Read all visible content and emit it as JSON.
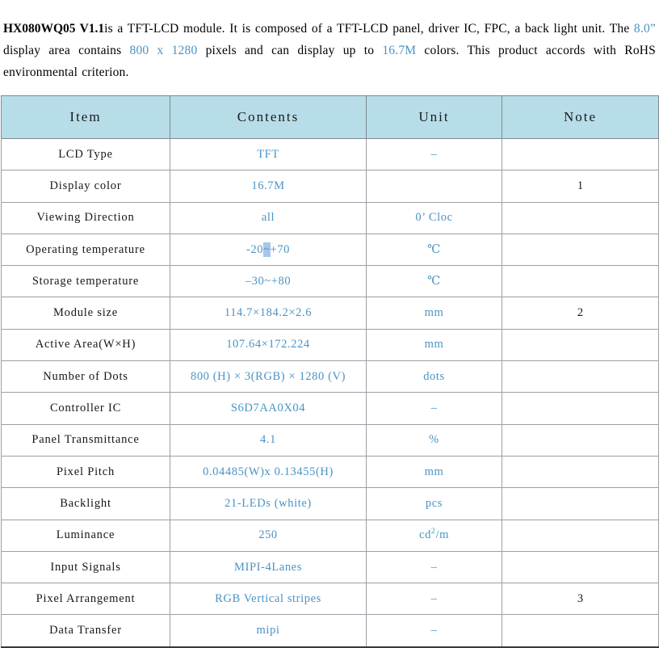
{
  "intro": {
    "model": "HX080WQ05 V1.1",
    "segment_1": "is a TFT-LCD module. It is composed of a TFT-LCD panel, driver IC, FPC, a back light unit. The ",
    "size_value": "8.0”",
    "segment_2": " display area contains ",
    "resolution_value": "800 x 1280",
    "segment_3": " pixels and can display up to ",
    "colors_value": "16.7M",
    "segment_4": " colors. This product accords with RoHS environmental criterion."
  },
  "table": {
    "headers": [
      "Item",
      "Contents",
      "Unit",
      "Note"
    ],
    "rows": [
      {
        "item": "LCD Type",
        "content": "TFT",
        "unit": "–",
        "note": ""
      },
      {
        "item": "Display color",
        "content": "16.7M",
        "unit": "",
        "note": "1"
      },
      {
        "item": "Viewing Direction",
        "content": "all",
        "unit": "0’ Cloc",
        "note": ""
      },
      {
        "item": "Operating temperature",
        "content": "-20~+70",
        "unit": "℃",
        "note": "",
        "selection": "~"
      },
      {
        "item": "Storage temperature",
        "content": "–30~+80",
        "unit": "℃",
        "note": ""
      },
      {
        "item": "Module size",
        "content": "114.7×184.2×2.6",
        "unit": "mm",
        "note": "2"
      },
      {
        "item": "Active Area(W×H)",
        "content": "107.64×172.224",
        "unit": "mm",
        "note": ""
      },
      {
        "item": "Number of Dots",
        "content": "800 (H) × 3(RGB) × 1280 (V)",
        "unit": "dots",
        "note": ""
      },
      {
        "item": "Controller IC",
        "content": "S6D7AA0X04",
        "unit": "–",
        "note": ""
      },
      {
        "item": "Panel Transmittance",
        "content": "4.1",
        "unit": "%",
        "note": ""
      },
      {
        "item": "Pixel Pitch",
        "content": "0.04485(W)x 0.13455(H)",
        "unit": "mm",
        "note": ""
      },
      {
        "item": "Backlight",
        "content": "21-LEDs (white)",
        "unit": "pcs",
        "note": ""
      },
      {
        "item": "Luminance",
        "content": "250",
        "unit": "cd2/m",
        "unit_sup": true,
        "note": ""
      },
      {
        "item": "Input Signals",
        "content": "MIPI-4Lanes",
        "unit": "–",
        "note": ""
      },
      {
        "item": "Pixel Arrangement",
        "content": "RGB Vertical stripes",
        "unit": "–",
        "note": "3"
      },
      {
        "item": "Data Transfer",
        "content": "mipi",
        "unit": "–",
        "note": ""
      }
    ]
  },
  "colors": {
    "header_background": "#b7dde8",
    "value_text": "#4a93c4",
    "selection_highlight": "#a8c6ea",
    "border": "#9aa0a6"
  }
}
